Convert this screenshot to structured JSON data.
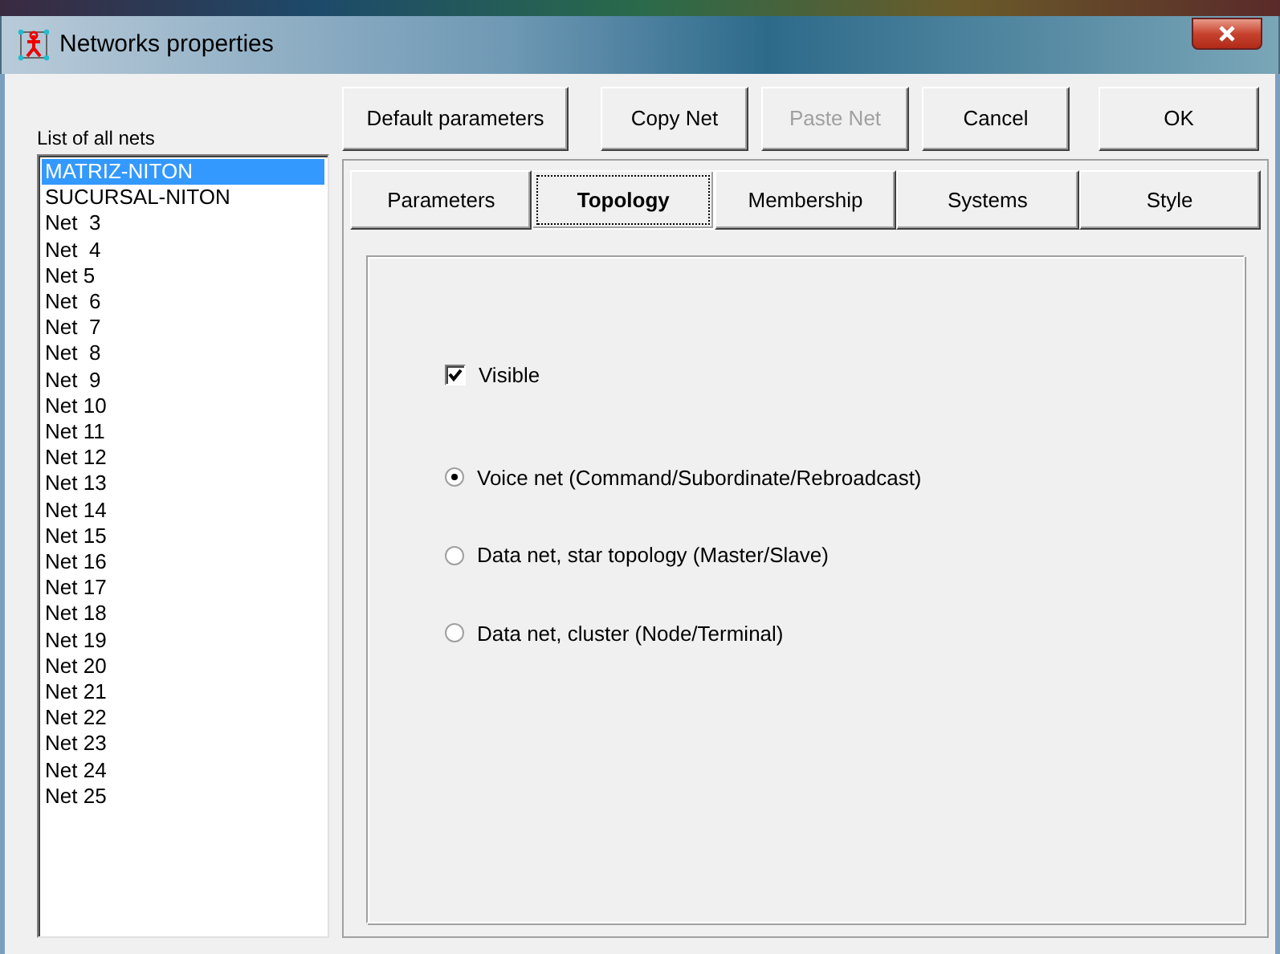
{
  "window": {
    "title": "Networks properties"
  },
  "buttons": [
    {
      "label": "Default parameters",
      "disabled": false
    },
    {
      "label": "Copy Net",
      "disabled": false
    },
    {
      "label": "Paste Net",
      "disabled": true
    },
    {
      "label": "Cancel",
      "disabled": false
    },
    {
      "label": "OK",
      "disabled": false
    }
  ],
  "nets_list": {
    "label": "List of all nets",
    "items": [
      {
        "label": "MATRIZ-NITON",
        "selected": true
      },
      {
        "label": "SUCURSAL-NITON",
        "selected": false
      },
      {
        "label": "Net  3",
        "selected": false
      },
      {
        "label": "Net  4",
        "selected": false
      },
      {
        "label": "Net 5",
        "selected": false
      },
      {
        "label": "Net  6",
        "selected": false
      },
      {
        "label": "Net  7",
        "selected": false
      },
      {
        "label": "Net  8",
        "selected": false
      },
      {
        "label": "Net  9",
        "selected": false
      },
      {
        "label": "Net 10",
        "selected": false
      },
      {
        "label": "Net 11",
        "selected": false
      },
      {
        "label": "Net 12",
        "selected": false
      },
      {
        "label": "Net 13",
        "selected": false
      },
      {
        "label": "Net 14",
        "selected": false
      },
      {
        "label": "Net 15",
        "selected": false
      },
      {
        "label": "Net 16",
        "selected": false
      },
      {
        "label": "Net 17",
        "selected": false
      },
      {
        "label": "Net 18",
        "selected": false
      },
      {
        "label": "Net 19",
        "selected": false
      },
      {
        "label": "Net 20",
        "selected": false
      },
      {
        "label": "Net 21",
        "selected": false
      },
      {
        "label": "Net 22",
        "selected": false
      },
      {
        "label": "Net 23",
        "selected": false
      },
      {
        "label": "Net 24",
        "selected": false
      },
      {
        "label": "Net 25",
        "selected": false
      }
    ]
  },
  "tabs": [
    {
      "label": "Parameters",
      "selected": false
    },
    {
      "label": "Topology",
      "selected": true
    },
    {
      "label": "Membership",
      "selected": false
    },
    {
      "label": "Systems",
      "selected": false
    },
    {
      "label": "Style",
      "selected": false
    }
  ],
  "topology": {
    "visible": {
      "label": "Visible",
      "checked": true
    },
    "net_types": [
      {
        "label": "Voice net (Command/Subordinate/Rebroadcast)",
        "selected": true
      },
      {
        "label": "Data net, star topology (Master/Slave)",
        "selected": false
      },
      {
        "label": "Data net, cluster (Node/Terminal)",
        "selected": false
      }
    ]
  }
}
